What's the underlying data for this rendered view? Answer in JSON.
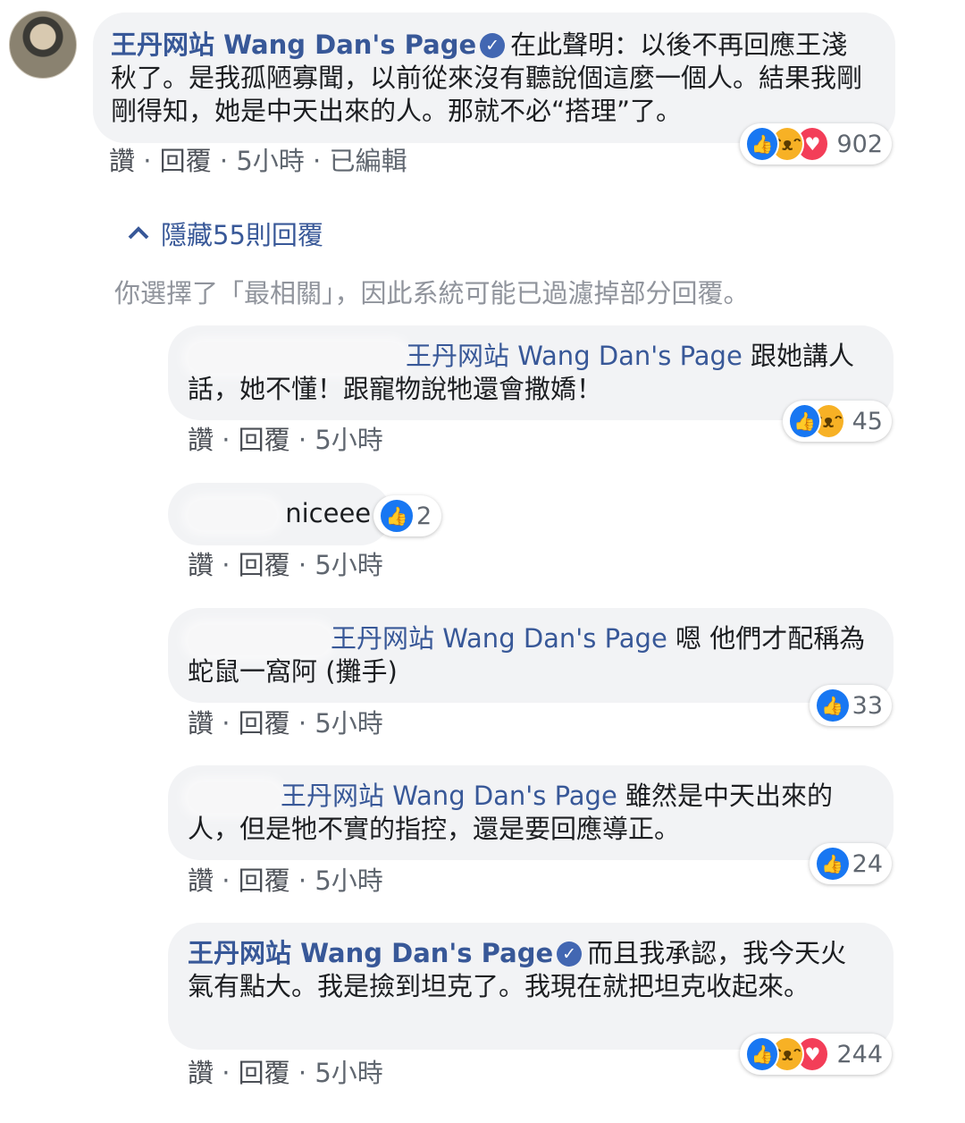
{
  "hide_replies": {
    "chevron": "chevron-up-icon",
    "label": "隱藏55則回覆"
  },
  "filter_notice": "你選擇了「最相關」，因此系統可能已過濾掉部分回覆。",
  "meta_sep": " · ",
  "main_comment": {
    "author": "王丹网站 Wang Dan's Page",
    "text": "在此聲明：以後不再回應王淺秋了。是我孤陋寡聞，以前從來沒有聽說個這麼一個人。結果我剛剛得知，她是中天出來的人。那就不必“搭理”了。",
    "like": "讚",
    "reply": "回覆",
    "time": "5小時",
    "edited": "已編輯",
    "reaction_count": "902"
  },
  "replies": [
    {
      "tag": "王丹网站 Wang Dan's Page",
      "text": "跟她講人話，她不懂！跟寵物說牠還會撒嬌！",
      "like": "讚",
      "reply": "回覆",
      "time": "5小時",
      "reaction_count": "45"
    },
    {
      "text": "niceee",
      "like": "讚",
      "reply": "回覆",
      "time": "5小時",
      "reaction_count": "2"
    },
    {
      "tag": "王丹网站 Wang Dan's Page",
      "text": "嗯 他們才配稱為蛇鼠一窩阿 (攤手)",
      "like": "讚",
      "reply": "回覆",
      "time": "5小時",
      "reaction_count": "33"
    },
    {
      "tag": "王丹网站 Wang Dan's Page",
      "text": "雖然是中天出來的人，但是牠不實的指控，還是要回應導正。",
      "like": "讚",
      "reply": "回覆",
      "time": "5小時",
      "reaction_count": "24"
    },
    {
      "author": "王丹网站 Wang Dan's Page",
      "text": "而且我承認，我今天火氣有點大。我是撿到坦克了。我現在就把坦克收起來。",
      "like": "讚",
      "reply": "回覆",
      "time": "5小時",
      "reaction_count": "244"
    }
  ],
  "icons": {
    "like": "like-reaction-icon",
    "haha": "haha-reaction-icon",
    "love": "love-reaction-icon",
    "verified": "verified-badge-icon"
  },
  "colors": {
    "link": "#385898",
    "bubble": "#f2f3f5",
    "meta": "#606770",
    "like": "#1877f2",
    "haha": "#f7b125",
    "love": "#f33e58"
  }
}
